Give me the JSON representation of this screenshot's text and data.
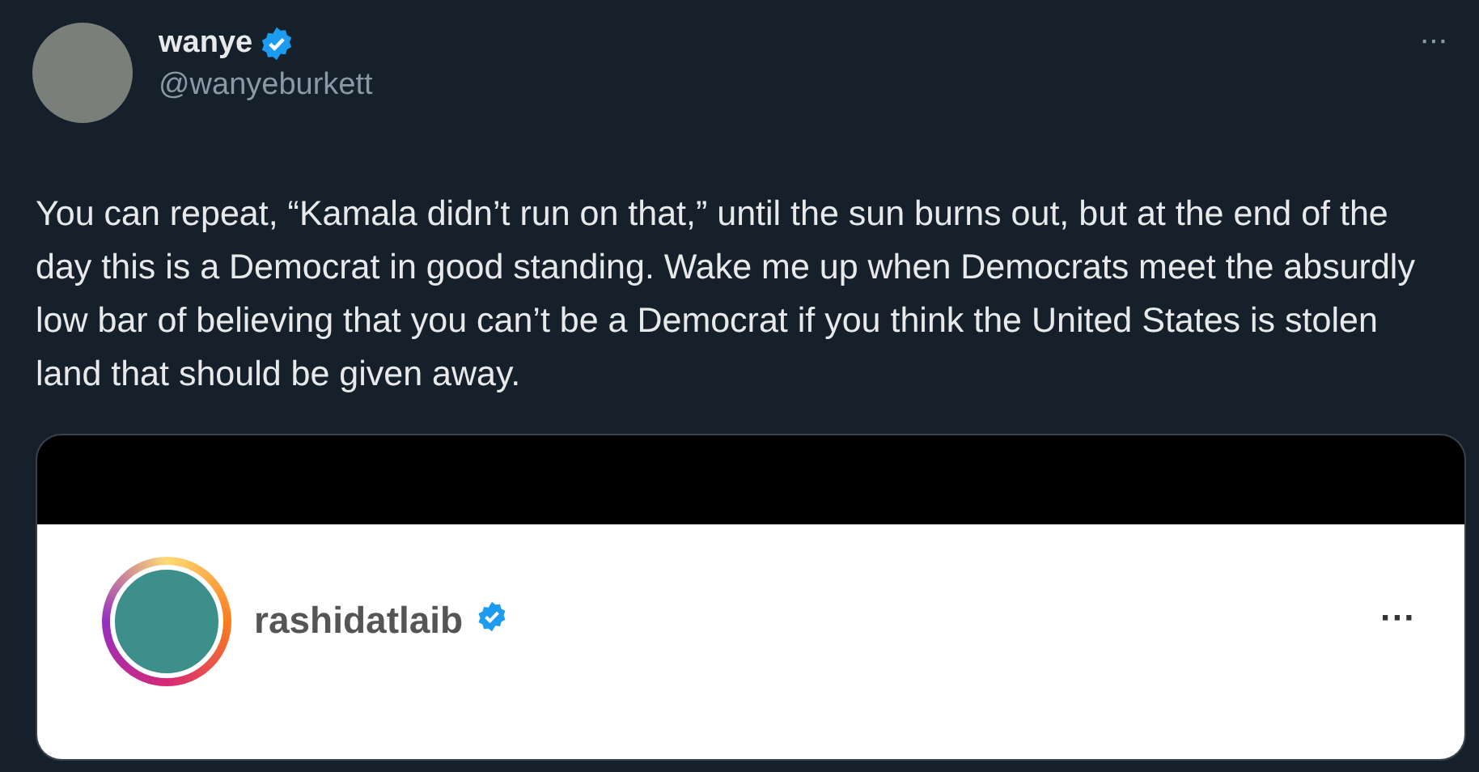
{
  "author": {
    "name": "wanye",
    "verified": true,
    "handle": "@wanyeburkett",
    "more": "···"
  },
  "text": "You can repeat, “Kamala didn’t run on that,” until the sun burns out, but at the end of the day this is a Democrat in good standing. Wake me up when Democrats meet the absurdly low bar of believing that you can’t be a Democrat if you think the United States is stolen land that should be given away.",
  "embedded_screenshot": {
    "username": "rashidatlaib",
    "verified": true,
    "more": "···"
  }
}
